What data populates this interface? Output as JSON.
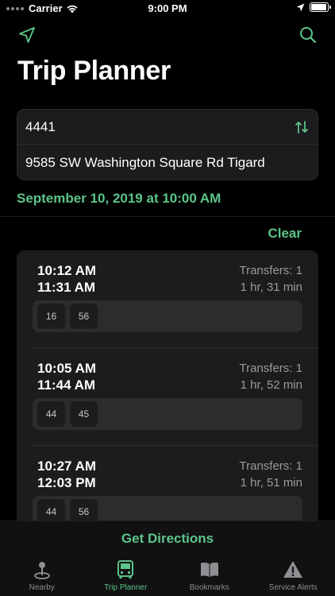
{
  "status_bar": {
    "carrier": "Carrier",
    "time": "9:00 PM"
  },
  "header": {
    "title": "Trip Planner"
  },
  "route": {
    "from": "4441",
    "to": "9585 SW Washington Square Rd Tigard"
  },
  "date": "September 10, 2019 at 10:00 AM",
  "clear_label": "Clear",
  "trips": [
    {
      "depart": "10:12 AM",
      "arrive": "11:31 AM",
      "transfers_label": "Transfers:",
      "transfers": "1",
      "duration": "1 hr, 31 min",
      "routes": [
        "16",
        "56"
      ]
    },
    {
      "depart": "10:05 AM",
      "arrive": "11:44 AM",
      "transfers_label": "Transfers:",
      "transfers": "1",
      "duration": "1 hr, 52 min",
      "routes": [
        "44",
        "45"
      ]
    },
    {
      "depart": "10:27 AM",
      "arrive": "12:03 PM",
      "transfers_label": "Transfers:",
      "transfers": "1",
      "duration": "1 hr, 51 min",
      "routes": [
        "44",
        "56"
      ]
    }
  ],
  "get_directions_label": "Get Directions",
  "tabs": [
    {
      "label": "Nearby",
      "icon": "map-pin-icon"
    },
    {
      "label": "Trip Planner",
      "icon": "bus-icon",
      "active": true
    },
    {
      "label": "Bookmarks",
      "icon": "book-icon"
    },
    {
      "label": "Service Alerts",
      "icon": "warning-icon"
    }
  ],
  "colors": {
    "accent": "#5cc48a",
    "background": "#000000",
    "card": "#1c1c1e"
  },
  "battery_level": 0.95
}
